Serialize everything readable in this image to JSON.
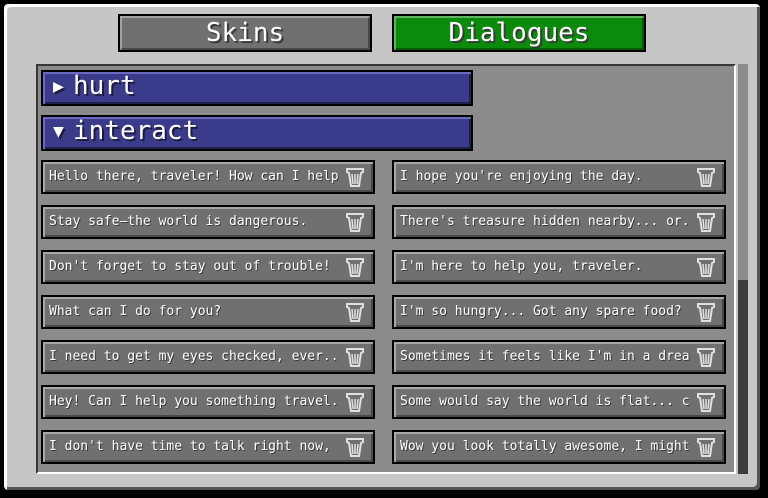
{
  "tabs": [
    {
      "label": "Skins"
    },
    {
      "label": "Dialogues"
    }
  ],
  "groups": [
    {
      "name": "hurt",
      "expanded": false
    },
    {
      "name": "interact",
      "expanded": true
    }
  ],
  "dialogues": [
    "Hello there, traveler! How can I help...",
    "I hope you're enjoying the day.",
    "Stay safe—the world is dangerous.",
    "There's treasure hidden nearby... or...",
    "Don't forget to stay out of trouble!",
    "I'm here to help you, traveler.",
    "What can I do for you?",
    "I'm so hungry... Got any spare food?",
    "I need to get my eyes checked, ever...",
    "Sometimes it feels like I'm in a dream. ...",
    "Hey! Can I help you something travel...",
    "Some would say the world is flat... ca...",
    "I don't have time to talk right now, I'm...",
    "Wow you look totally awesome, I might..."
  ],
  "icons": {
    "collapsed": "triangle-right-icon",
    "expanded": "triangle-down-icon",
    "delete": "trash-can-icon"
  },
  "colors": {
    "selected_tab": "#0b8a0b",
    "group_header": "#3b3b8c"
  }
}
